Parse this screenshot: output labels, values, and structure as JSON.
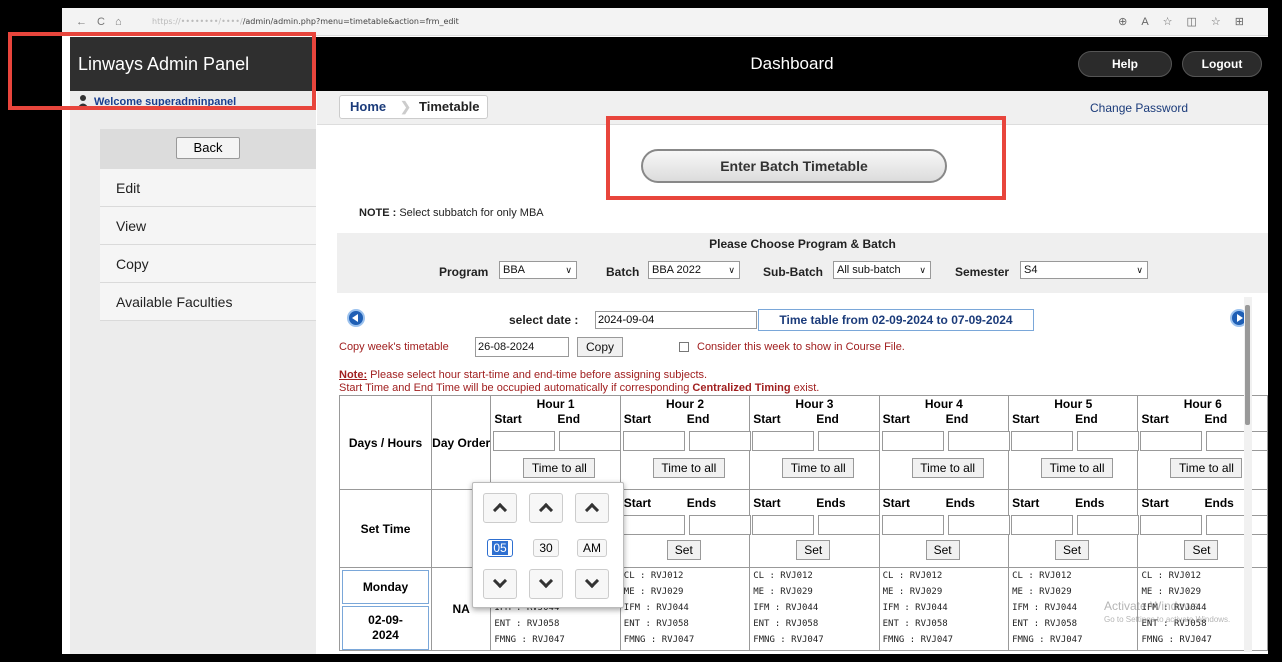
{
  "browser": {
    "url": "/admin/admin.php?menu=timetable&action=frm_edit"
  },
  "header": {
    "brand": "Linways Admin Panel",
    "title": "Dashboard",
    "help_label": "Help",
    "logout_label": "Logout"
  },
  "sidebar": {
    "welcome": "Welcome superadminpanel",
    "back_label": "Back",
    "items": [
      "Edit",
      "View",
      "Copy",
      "Available Faculties"
    ]
  },
  "breadcrumb": {
    "home": "Home",
    "current": "Timetable",
    "change_password": "Change Password"
  },
  "main": {
    "enter_button": "Enter Batch Timetable",
    "note_label": "NOTE :",
    "note_text": "Select subbatch for only MBA",
    "choose_title": "Please Choose Program & Batch",
    "program_label": "Program",
    "program_value": "BBA",
    "batch_label": "Batch",
    "batch_value": "BBA 2022",
    "subbatch_label": "Sub-Batch",
    "subbatch_value": "All sub-batch",
    "semester_label": "Semester",
    "semester_value": "S4"
  },
  "timetable": {
    "select_date_label": "select date :",
    "select_date_value": "2024-09-04",
    "range": "Time table from 02-09-2024 to 07-09-2024",
    "copy_label": "Copy week's timetable",
    "copy_date": "26-08-2024",
    "copy_button": "Copy",
    "consider_label": "Consider this week to show in Course File.",
    "note_label": "Note:",
    "note_line1": "Please select hour start-time and end-time before assigning subjects.",
    "note_line2_a": "Start Time and End Time will be occupied automatically if corresponding",
    "note_line2_b": "Centralized Timing",
    "note_line2_c": "exist.",
    "days_hours": "Days / Hours",
    "day_order": "Day Order",
    "set_time": "Set Time",
    "start": "Start",
    "end": "End",
    "ends": "Ends",
    "time_to_all": "Time to all",
    "set": "Set",
    "hours": [
      "Hour 1",
      "Hour 2",
      "Hour 3",
      "Hour 4",
      "Hour 5",
      "Hour 6"
    ],
    "day": "Monday",
    "date": "02-09-2024",
    "day_order_value": "NA",
    "subjects": [
      "CL : RVJ012",
      "ME : RVJ029",
      "IFM : RVJ044",
      "ENT : RVJ058",
      "FMNG : RVJ047"
    ]
  },
  "time_picker": {
    "hour": "05",
    "minute": "30",
    "meridiem": "AM"
  },
  "watermark": {
    "line1": "Activate Windows",
    "line2": "Go to Settings to activate Windows."
  }
}
